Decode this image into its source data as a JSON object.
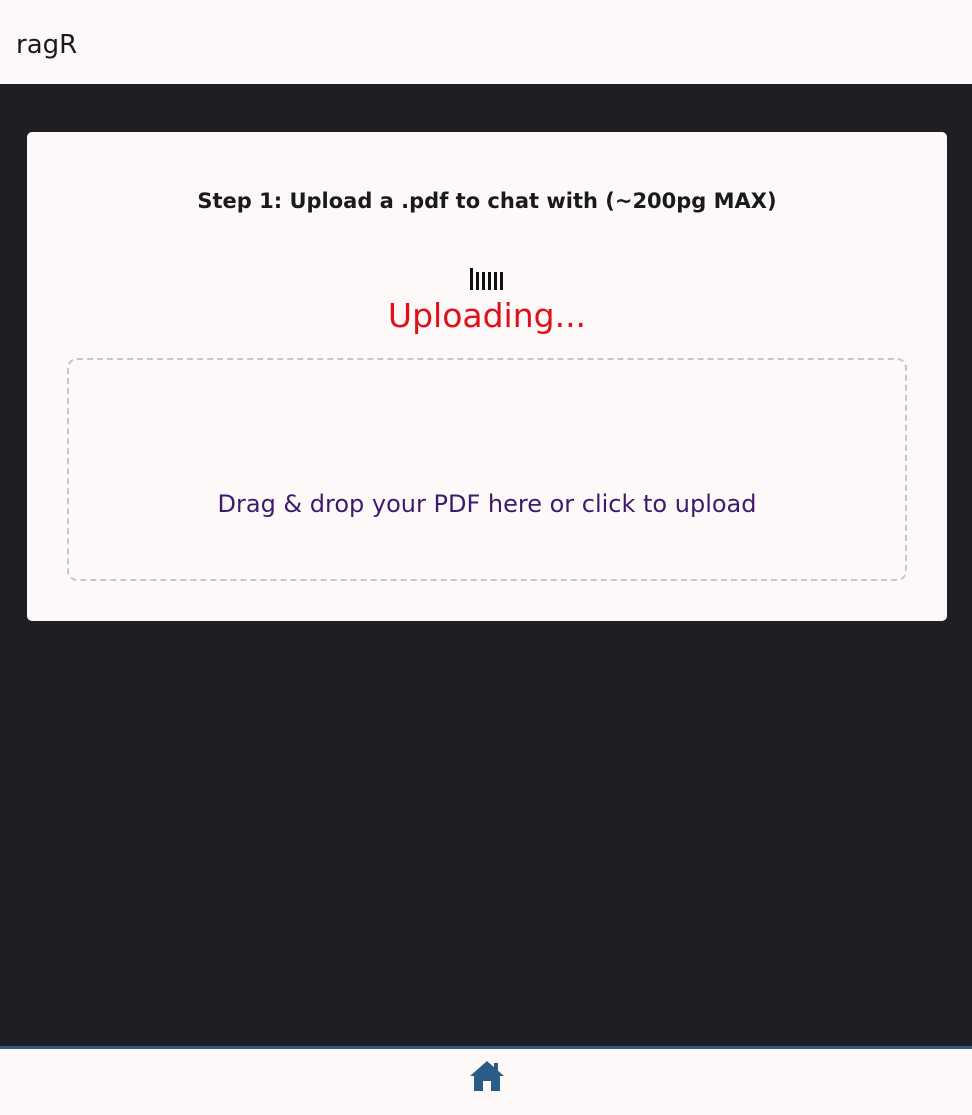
{
  "header": {
    "app_title": "ragR"
  },
  "upload": {
    "step_heading": "Step 1: Upload a .pdf to chat with (~200pg MAX)",
    "status": "Uploading...",
    "dropzone_text": "Drag & drop your PDF here or click to upload"
  },
  "footer": {
    "home_icon": "home-icon"
  },
  "colors": {
    "background": "#1f1e23",
    "surface": "#fdf9f9",
    "status": "#e0101a",
    "dropzone_text": "#3e1a6e",
    "footer_accent": "#2a5c86"
  }
}
